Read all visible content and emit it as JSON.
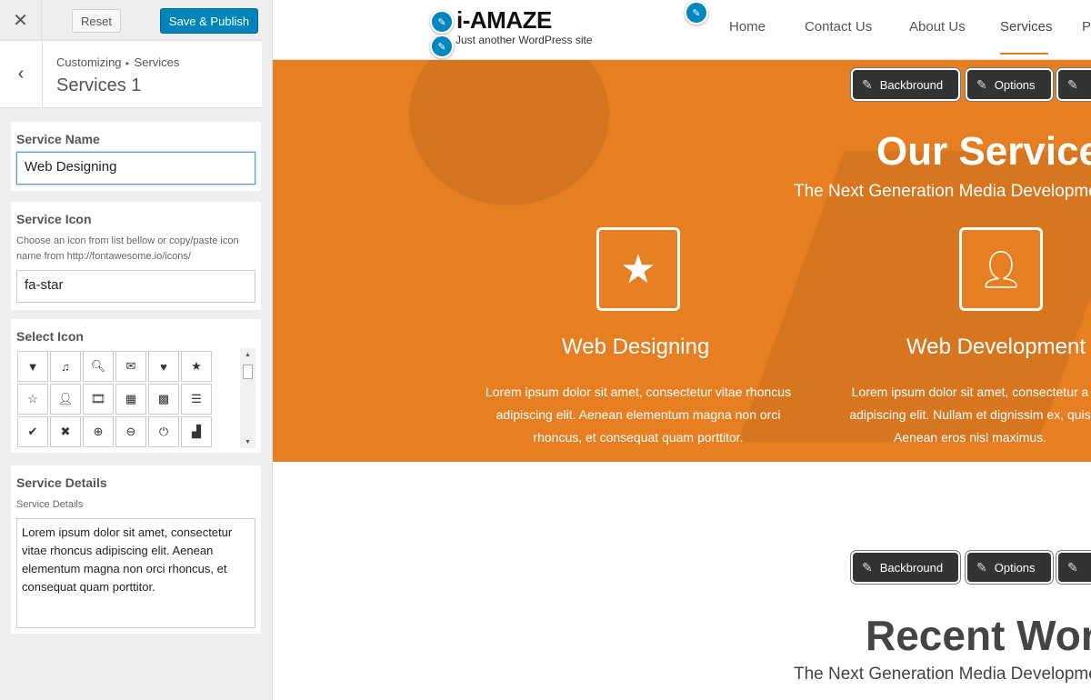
{
  "sidebar": {
    "close_glyph": "✕",
    "reset_label": "Reset",
    "publish_label": "Save & Publish",
    "back_glyph": "‹",
    "breadcrumb_root": "Customizing",
    "breadcrumb_sep": "▸",
    "breadcrumb_leaf": "Services",
    "section_title": "Services 1",
    "service_name": {
      "label": "Service Name",
      "value": "Web Designing"
    },
    "service_icon": {
      "label": "Service Icon",
      "description": "Choose an icon from list bellow or copy/paste icon name from http://fontawesome.io/icons/",
      "value": "fa-star"
    },
    "select_icon": {
      "label": "Select Icon",
      "icons": [
        {
          "name": "filter-icon",
          "glyph": "▼"
        },
        {
          "name": "music-icon",
          "glyph": "♫"
        },
        {
          "name": "search-icon",
          "glyph": "🔍︎"
        },
        {
          "name": "envelope-icon",
          "glyph": "✉"
        },
        {
          "name": "heart-icon",
          "glyph": "♥"
        },
        {
          "name": "star-icon",
          "glyph": "★"
        },
        {
          "name": "star-outline-icon",
          "glyph": "☆"
        },
        {
          "name": "user-icon",
          "glyph": "👤︎"
        },
        {
          "name": "film-icon",
          "glyph": "🎞︎"
        },
        {
          "name": "th-large-icon",
          "glyph": "▦"
        },
        {
          "name": "th-icon",
          "glyph": "▩"
        },
        {
          "name": "th-list-icon",
          "glyph": "☰"
        },
        {
          "name": "check-icon",
          "glyph": "✔"
        },
        {
          "name": "times-icon",
          "glyph": "✖"
        },
        {
          "name": "zoom-in-icon",
          "glyph": "⊕"
        },
        {
          "name": "zoom-out-icon",
          "glyph": "⊖"
        },
        {
          "name": "power-off-icon",
          "glyph": "⏻"
        },
        {
          "name": "signal-icon",
          "glyph": "▟"
        }
      ]
    },
    "service_details": {
      "label": "Service Details",
      "description": "Service Details",
      "value": "Lorem ipsum dolor sit amet, consectetur vitae rhoncus adipiscing elit. Aenean elementum magna non orci rhoncus, et consequat quam porttitor."
    }
  },
  "site": {
    "title": "i-AMAZE",
    "tagline": "Just another WordPress site",
    "nav": [
      "Home",
      "Contact Us",
      "About Us",
      "Services",
      "P"
    ],
    "active_nav_color": "#e67e22"
  },
  "edit_chips": {
    "background": "Backbround",
    "options": "Options"
  },
  "services_section": {
    "title": "Our Services",
    "subtitle": "The Next Generation Media Development",
    "accent": "#e67e22",
    "items": [
      {
        "icon": "star-icon",
        "glyph": "★",
        "title": "Web Designing",
        "text": "Lorem ipsum dolor sit amet, consectetur vitae rhoncus adipiscing elit. Aenean elementum magna non orci rhoncus, et consequat quam porttitor."
      },
      {
        "icon": "user-icon",
        "glyph": "👤︎",
        "title": "Web Development",
        "text": "Lorem ipsum dolor sit amet, consectetur a adipiscing elit. Nullam et dignissim ex, quis Aenean eros nisl maximus."
      }
    ]
  },
  "recent_section": {
    "title": "Recent Work",
    "subtitle": "The Next Generation Media Development"
  }
}
